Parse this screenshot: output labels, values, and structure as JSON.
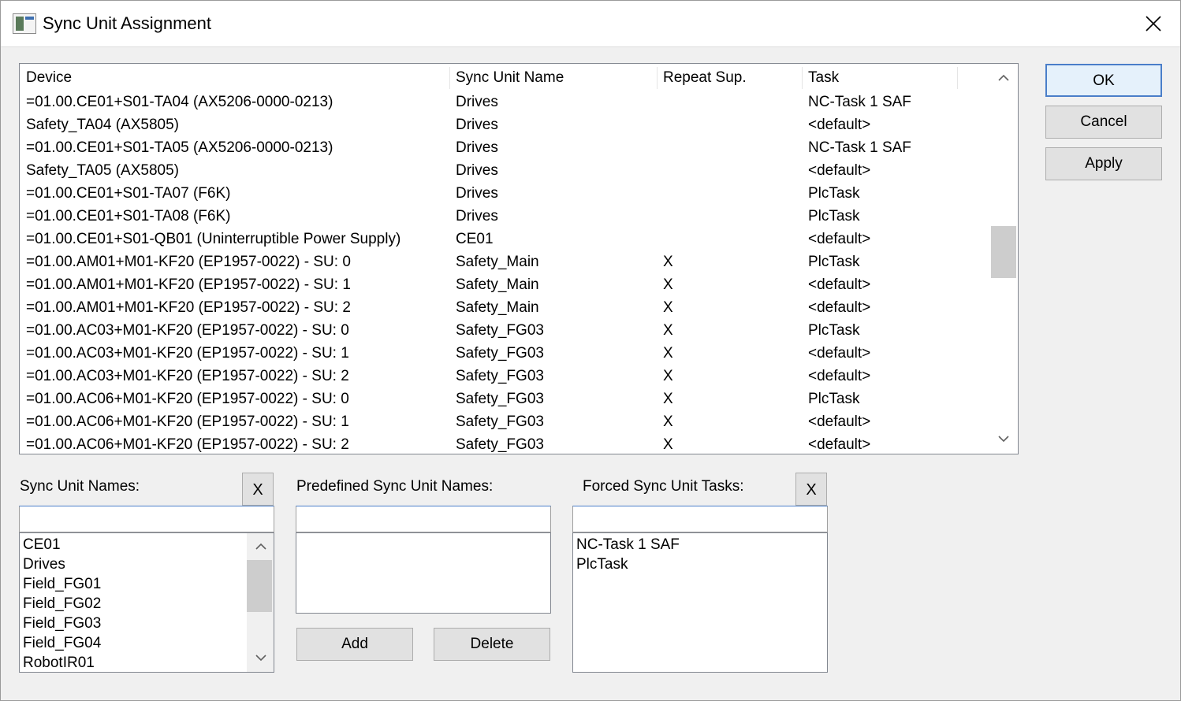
{
  "window": {
    "title": "Sync Unit Assignment",
    "close_glyph": "✕"
  },
  "grid": {
    "columns": [
      "Device",
      "Sync Unit Name",
      "Repeat Sup.",
      "Task"
    ],
    "rows": [
      {
        "device": "=01.00.CE01+S01-TA04 (AX5206-0000-0213)",
        "sync": "Drives",
        "repeat": "",
        "task": "NC-Task 1 SAF"
      },
      {
        "device": "Safety_TA04 (AX5805)",
        "sync": "Drives",
        "repeat": "",
        "task": "<default>"
      },
      {
        "device": "=01.00.CE01+S01-TA05 (AX5206-0000-0213)",
        "sync": "Drives",
        "repeat": "",
        "task": "NC-Task 1 SAF"
      },
      {
        "device": "Safety_TA05 (AX5805)",
        "sync": "Drives",
        "repeat": "",
        "task": "<default>"
      },
      {
        "device": "=01.00.CE01+S01-TA07 (F6K)",
        "sync": "Drives",
        "repeat": "",
        "task": "PlcTask"
      },
      {
        "device": "=01.00.CE01+S01-TA08 (F6K)",
        "sync": "Drives",
        "repeat": "",
        "task": "PlcTask"
      },
      {
        "device": "=01.00.CE01+S01-QB01 (Uninterruptible Power Supply)",
        "sync": "CE01",
        "repeat": "",
        "task": "<default>"
      },
      {
        "device": "=01.00.AM01+M01-KF20 (EP1957-0022) - SU: 0",
        "sync": "Safety_Main",
        "repeat": "X",
        "task": "PlcTask"
      },
      {
        "device": "=01.00.AM01+M01-KF20 (EP1957-0022) - SU: 1",
        "sync": "Safety_Main",
        "repeat": "X",
        "task": "<default>"
      },
      {
        "device": "=01.00.AM01+M01-KF20 (EP1957-0022) - SU: 2",
        "sync": "Safety_Main",
        "repeat": "X",
        "task": "<default>"
      },
      {
        "device": "=01.00.AC03+M01-KF20 (EP1957-0022) - SU: 0",
        "sync": "Safety_FG03",
        "repeat": "X",
        "task": "PlcTask"
      },
      {
        "device": "=01.00.AC03+M01-KF20 (EP1957-0022) - SU: 1",
        "sync": "Safety_FG03",
        "repeat": "X",
        "task": "<default>"
      },
      {
        "device": "=01.00.AC03+M01-KF20 (EP1957-0022) - SU: 2",
        "sync": "Safety_FG03",
        "repeat": "X",
        "task": "<default>"
      },
      {
        "device": "=01.00.AC06+M01-KF20 (EP1957-0022) - SU: 0",
        "sync": "Safety_FG03",
        "repeat": "X",
        "task": "PlcTask"
      },
      {
        "device": "=01.00.AC06+M01-KF20 (EP1957-0022) - SU: 1",
        "sync": "Safety_FG03",
        "repeat": "X",
        "task": "<default>"
      },
      {
        "device": "=01.00.AC06+M01-KF20 (EP1957-0022) - SU: 2",
        "sync": "Safety_FG03",
        "repeat": "X",
        "task": "<default>"
      }
    ]
  },
  "buttons": {
    "ok": "OK",
    "cancel": "Cancel",
    "apply": "Apply",
    "add": "Add",
    "delete": "Delete",
    "clear": "X"
  },
  "sync_unit_names": {
    "label": "Sync Unit Names:",
    "input_value": "",
    "items": [
      "CE01",
      "Drives",
      "Field_FG01",
      "Field_FG02",
      "Field_FG03",
      "Field_FG04",
      "RobotIR01"
    ]
  },
  "predefined": {
    "label": "Predefined Sync Unit Names:",
    "input_value": "",
    "items": []
  },
  "forced_tasks": {
    "label": "Forced Sync Unit Tasks:",
    "input_value": "",
    "items": [
      "NC-Task 1 SAF",
      "PlcTask"
    ]
  }
}
